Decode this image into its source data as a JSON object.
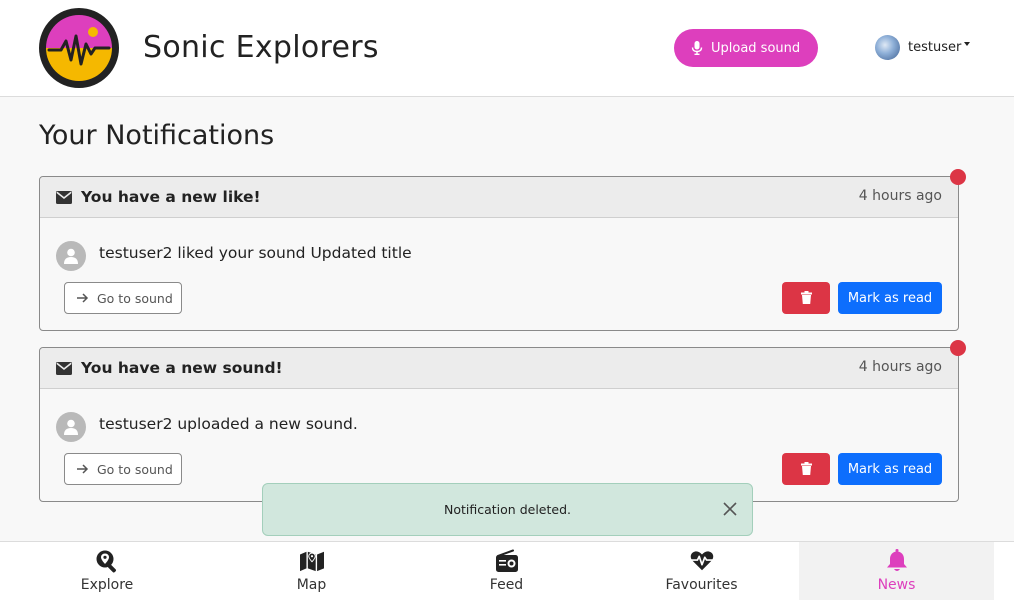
{
  "header": {
    "brand": "Sonic Explorers",
    "upload_label": "Upload sound",
    "username": "testuser"
  },
  "page": {
    "title": "Your Notifications"
  },
  "notifications": [
    {
      "title": "You have a new like!",
      "time": "4 hours ago",
      "message": "testuser2 liked your sound Updated title",
      "goto_label": "Go to sound",
      "read_label": "Mark as read",
      "unread": true
    },
    {
      "title": "You have a new sound!",
      "time": "4 hours ago",
      "message": "testuser2 uploaded a new sound.",
      "goto_label": "Go to sound",
      "read_label": "Mark as read",
      "unread": true
    }
  ],
  "toast": {
    "message": "Notification deleted."
  },
  "bottom_nav": {
    "items": [
      {
        "label": "Explore",
        "icon": "search-location-icon"
      },
      {
        "label": "Map",
        "icon": "map-icon"
      },
      {
        "label": "Feed",
        "icon": "radio-icon"
      },
      {
        "label": "Favourites",
        "icon": "heartbeat-icon"
      },
      {
        "label": "News",
        "icon": "bell-icon",
        "active": true
      }
    ]
  },
  "colors": {
    "accent": "#dd3fbd",
    "danger": "#dc3545",
    "primary": "#0d6efd",
    "toast_bg": "#d1e7dd"
  }
}
